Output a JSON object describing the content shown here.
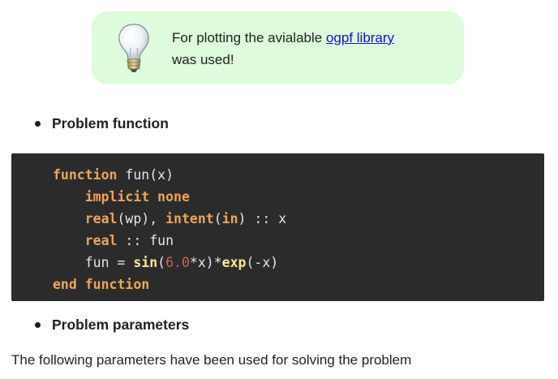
{
  "note": {
    "text_before": "For plotting the avialable ",
    "link_text": "ogpf library",
    "text_after": "was used!",
    "icon": "lightbulb-icon",
    "background": "#dcfcdb"
  },
  "sections": {
    "problem_function": "Problem function",
    "problem_parameters": "Problem parameters"
  },
  "code": {
    "line1": {
      "kw": "function",
      "rest": " fun(x)"
    },
    "line2": {
      "indent": "    ",
      "kw": "implicit none"
    },
    "line3": {
      "indent": "    ",
      "kw1": "real",
      "mid1": "(wp), ",
      "kw2": "intent",
      "mid2": "(",
      "kw3": "in",
      "rest": ") :: x"
    },
    "line4": {
      "indent": "    ",
      "kw": "real",
      "rest": " :: fun"
    },
    "line5": {
      "indent": "    ",
      "pre": "fun = ",
      "fn1": "sin",
      "open": "(",
      "num": "6.0",
      "mid": "*x)*",
      "fn2": "exp",
      "rest": "(-x)"
    },
    "line6": {
      "kw": "end function"
    }
  },
  "paragraph": "The following parameters have been used for solving the problem"
}
